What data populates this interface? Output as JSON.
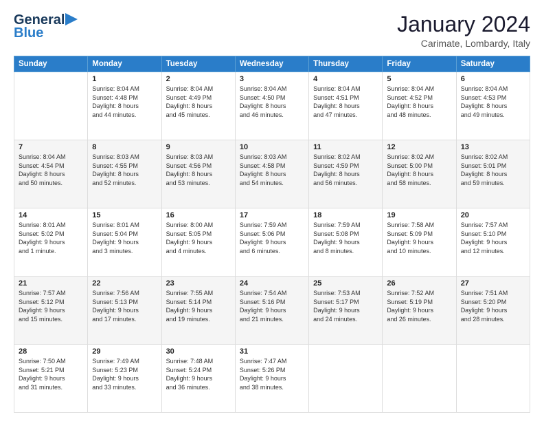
{
  "logo": {
    "line1": "General",
    "line2": "Blue"
  },
  "title": "January 2024",
  "subtitle": "Carimate, Lombardy, Italy",
  "days_of_week": [
    "Sunday",
    "Monday",
    "Tuesday",
    "Wednesday",
    "Thursday",
    "Friday",
    "Saturday"
  ],
  "weeks": [
    [
      {
        "day": "",
        "info": ""
      },
      {
        "day": "1",
        "info": "Sunrise: 8:04 AM\nSunset: 4:48 PM\nDaylight: 8 hours\nand 44 minutes."
      },
      {
        "day": "2",
        "info": "Sunrise: 8:04 AM\nSunset: 4:49 PM\nDaylight: 8 hours\nand 45 minutes."
      },
      {
        "day": "3",
        "info": "Sunrise: 8:04 AM\nSunset: 4:50 PM\nDaylight: 8 hours\nand 46 minutes."
      },
      {
        "day": "4",
        "info": "Sunrise: 8:04 AM\nSunset: 4:51 PM\nDaylight: 8 hours\nand 47 minutes."
      },
      {
        "day": "5",
        "info": "Sunrise: 8:04 AM\nSunset: 4:52 PM\nDaylight: 8 hours\nand 48 minutes."
      },
      {
        "day": "6",
        "info": "Sunrise: 8:04 AM\nSunset: 4:53 PM\nDaylight: 8 hours\nand 49 minutes."
      }
    ],
    [
      {
        "day": "7",
        "info": "Sunrise: 8:04 AM\nSunset: 4:54 PM\nDaylight: 8 hours\nand 50 minutes."
      },
      {
        "day": "8",
        "info": "Sunrise: 8:03 AM\nSunset: 4:55 PM\nDaylight: 8 hours\nand 52 minutes."
      },
      {
        "day": "9",
        "info": "Sunrise: 8:03 AM\nSunset: 4:56 PM\nDaylight: 8 hours\nand 53 minutes."
      },
      {
        "day": "10",
        "info": "Sunrise: 8:03 AM\nSunset: 4:58 PM\nDaylight: 8 hours\nand 54 minutes."
      },
      {
        "day": "11",
        "info": "Sunrise: 8:02 AM\nSunset: 4:59 PM\nDaylight: 8 hours\nand 56 minutes."
      },
      {
        "day": "12",
        "info": "Sunrise: 8:02 AM\nSunset: 5:00 PM\nDaylight: 8 hours\nand 58 minutes."
      },
      {
        "day": "13",
        "info": "Sunrise: 8:02 AM\nSunset: 5:01 PM\nDaylight: 8 hours\nand 59 minutes."
      }
    ],
    [
      {
        "day": "14",
        "info": "Sunrise: 8:01 AM\nSunset: 5:02 PM\nDaylight: 9 hours\nand 1 minute."
      },
      {
        "day": "15",
        "info": "Sunrise: 8:01 AM\nSunset: 5:04 PM\nDaylight: 9 hours\nand 3 minutes."
      },
      {
        "day": "16",
        "info": "Sunrise: 8:00 AM\nSunset: 5:05 PM\nDaylight: 9 hours\nand 4 minutes."
      },
      {
        "day": "17",
        "info": "Sunrise: 7:59 AM\nSunset: 5:06 PM\nDaylight: 9 hours\nand 6 minutes."
      },
      {
        "day": "18",
        "info": "Sunrise: 7:59 AM\nSunset: 5:08 PM\nDaylight: 9 hours\nand 8 minutes."
      },
      {
        "day": "19",
        "info": "Sunrise: 7:58 AM\nSunset: 5:09 PM\nDaylight: 9 hours\nand 10 minutes."
      },
      {
        "day": "20",
        "info": "Sunrise: 7:57 AM\nSunset: 5:10 PM\nDaylight: 9 hours\nand 12 minutes."
      }
    ],
    [
      {
        "day": "21",
        "info": "Sunrise: 7:57 AM\nSunset: 5:12 PM\nDaylight: 9 hours\nand 15 minutes."
      },
      {
        "day": "22",
        "info": "Sunrise: 7:56 AM\nSunset: 5:13 PM\nDaylight: 9 hours\nand 17 minutes."
      },
      {
        "day": "23",
        "info": "Sunrise: 7:55 AM\nSunset: 5:14 PM\nDaylight: 9 hours\nand 19 minutes."
      },
      {
        "day": "24",
        "info": "Sunrise: 7:54 AM\nSunset: 5:16 PM\nDaylight: 9 hours\nand 21 minutes."
      },
      {
        "day": "25",
        "info": "Sunrise: 7:53 AM\nSunset: 5:17 PM\nDaylight: 9 hours\nand 24 minutes."
      },
      {
        "day": "26",
        "info": "Sunrise: 7:52 AM\nSunset: 5:19 PM\nDaylight: 9 hours\nand 26 minutes."
      },
      {
        "day": "27",
        "info": "Sunrise: 7:51 AM\nSunset: 5:20 PM\nDaylight: 9 hours\nand 28 minutes."
      }
    ],
    [
      {
        "day": "28",
        "info": "Sunrise: 7:50 AM\nSunset: 5:21 PM\nDaylight: 9 hours\nand 31 minutes."
      },
      {
        "day": "29",
        "info": "Sunrise: 7:49 AM\nSunset: 5:23 PM\nDaylight: 9 hours\nand 33 minutes."
      },
      {
        "day": "30",
        "info": "Sunrise: 7:48 AM\nSunset: 5:24 PM\nDaylight: 9 hours\nand 36 minutes."
      },
      {
        "day": "31",
        "info": "Sunrise: 7:47 AM\nSunset: 5:26 PM\nDaylight: 9 hours\nand 38 minutes."
      },
      {
        "day": "",
        "info": ""
      },
      {
        "day": "",
        "info": ""
      },
      {
        "day": "",
        "info": ""
      }
    ]
  ]
}
